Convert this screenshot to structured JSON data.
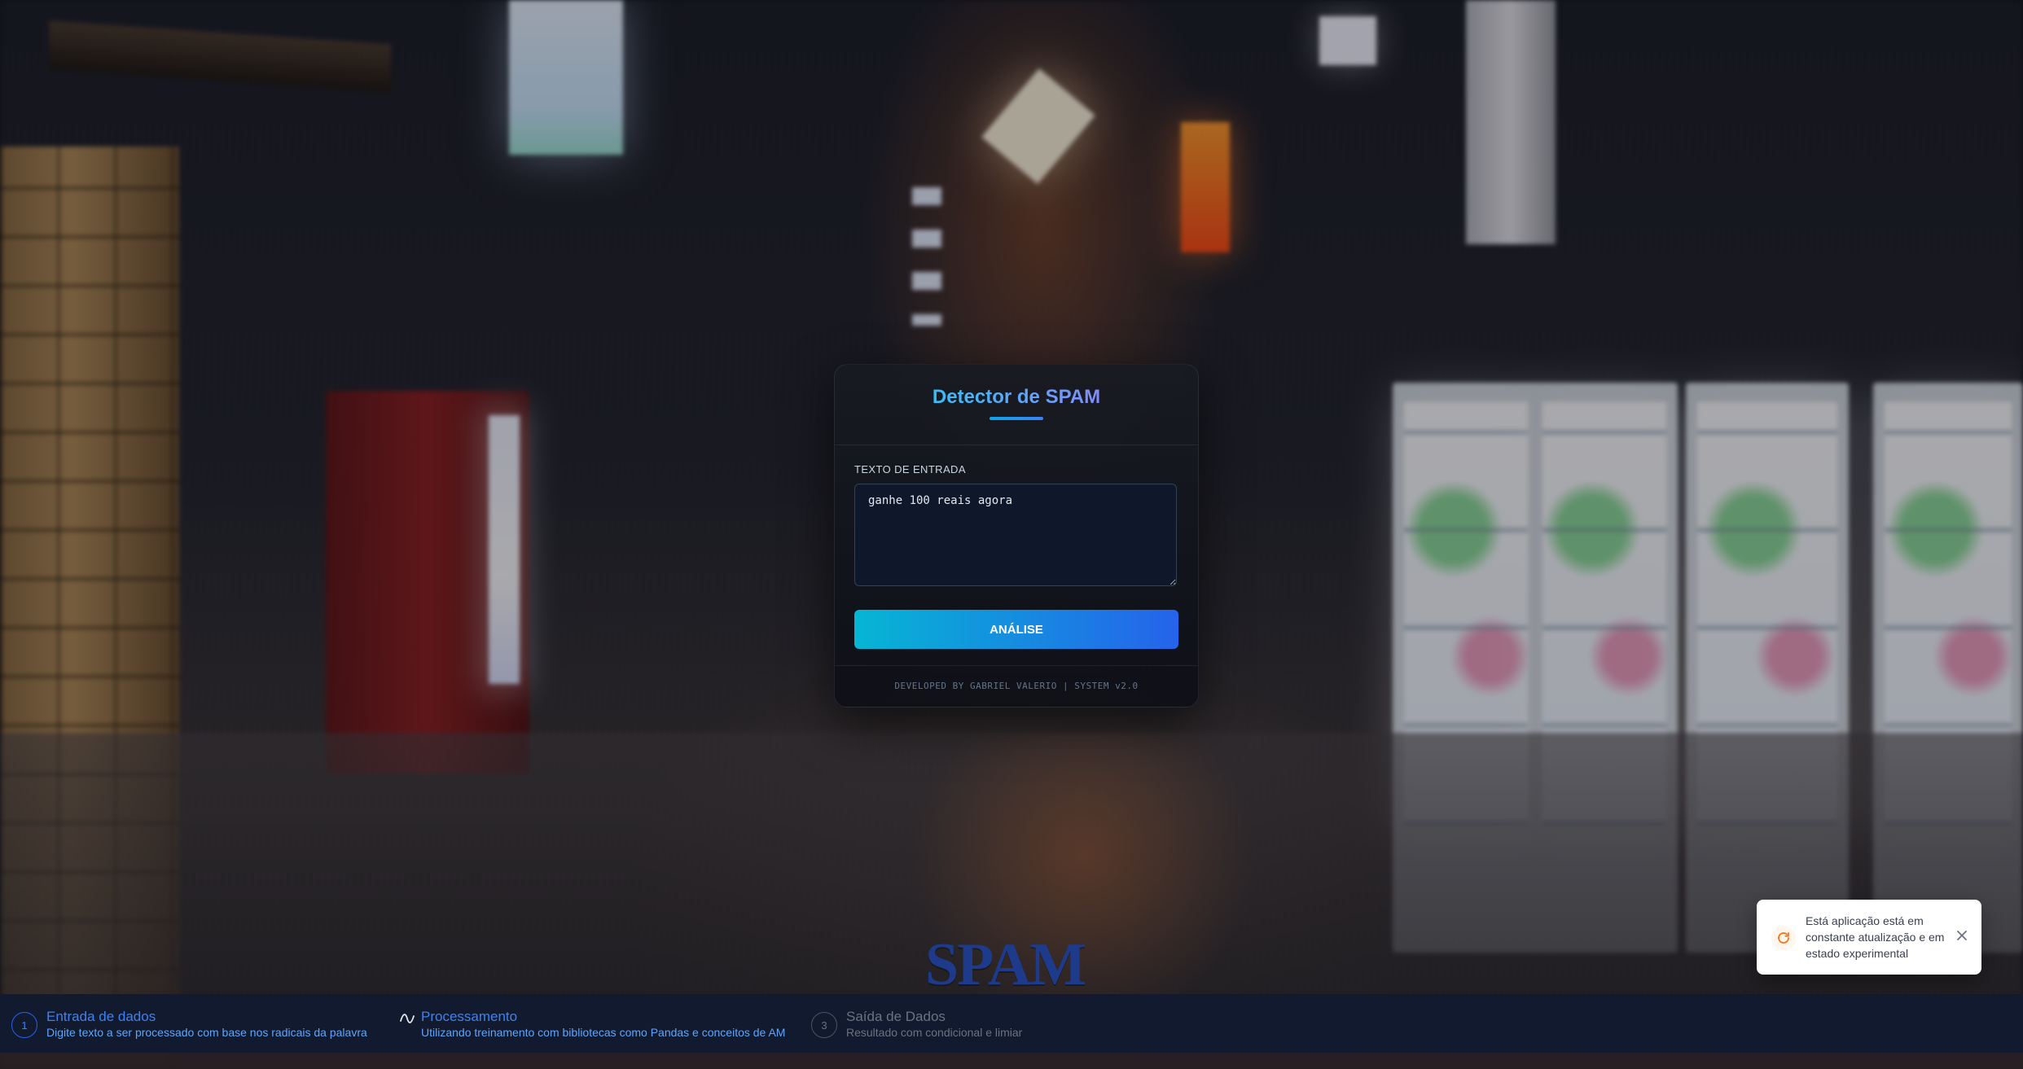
{
  "card": {
    "title": "Detector de SPAM",
    "input_label": "TEXTO DE ENTRADA",
    "input_value": "ganhe 100 reais agora",
    "analyze_label": "ANÁLISE",
    "footer": "DEVELOPED BY GABRIEL VALERIO | SYSTEM v2.0"
  },
  "logo": {
    "text": "SPAM"
  },
  "toast": {
    "message": "Está aplicação está em constante atualização e em estado experimental",
    "icon": "refresh-icon"
  },
  "steps": [
    {
      "number": "1",
      "title": "Entrada de dados",
      "description": "Digite texto a ser processado com base nos radicais da palavra",
      "state": "complete",
      "icon": "step-number"
    },
    {
      "title": "Processamento",
      "description": "Utilizando treinamento com bibliotecas como Pandas e conceitos de AM",
      "state": "active",
      "icon": "wave-icon"
    },
    {
      "number": "3",
      "title": "Saída de Dados",
      "description": "Resultado com condicional e limiar",
      "state": "pending",
      "icon": "step-number"
    }
  ],
  "colors": {
    "accent": "#3b82f6",
    "button_start": "#06b6d4",
    "button_end": "#2563eb",
    "toast_icon": "#f97316",
    "steps_bg": "#111a2e"
  }
}
